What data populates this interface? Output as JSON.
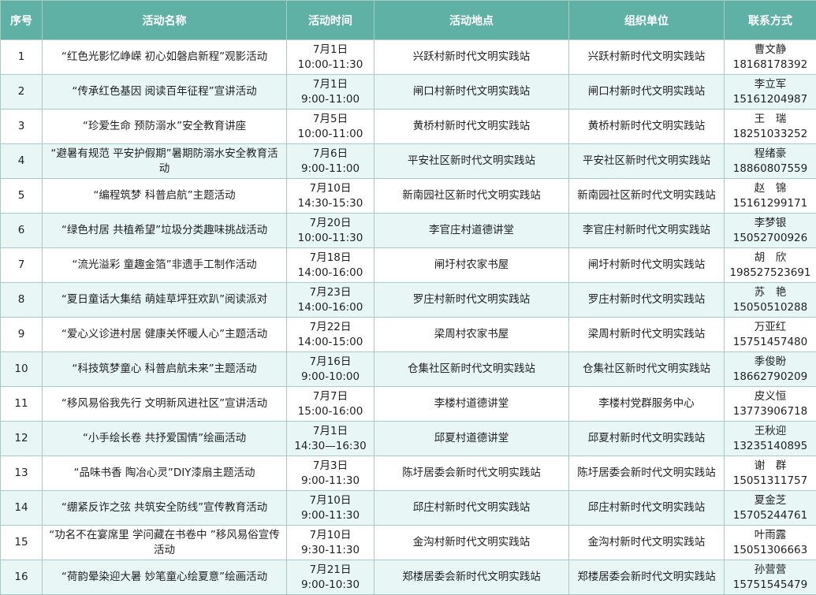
{
  "header": {
    "no": "序号",
    "name": "活动名称",
    "time": "活动时间",
    "place": "活动地点",
    "org": "组织单位",
    "contact": "联系方式"
  },
  "rows": [
    {
      "no": "1",
      "name": "“红色光影忆峥嵘 初心如磐启新程”观影活动",
      "date": "7月1日",
      "hours": "10:00-11:30",
      "place": "兴跃村新时代文明实践站",
      "org": "兴跃村新时代文明实践站",
      "person": "曹文静",
      "phone": "18168178392"
    },
    {
      "no": "2",
      "name": "“传承红色基因 阅读百年征程”宣讲活动",
      "date": "7月1日",
      "hours": "9:00-11:00",
      "place": "闸口村新时代文明实践站",
      "org": "闸口村新时代文明实践站",
      "person": "李立军",
      "phone": "15161204987"
    },
    {
      "no": "3",
      "name": "“珍爱生命 预防溺水”安全教育讲座",
      "date": "7月5日",
      "hours": "10:00-11:00",
      "place": "黄桥村新时代文明实践站",
      "org": "黄桥村新时代文明实践站",
      "person": "王　瑞",
      "phone": "18251033252"
    },
    {
      "no": "4",
      "name": "“避暑有规范 平安护假期”暑期防溺水安全教育活动",
      "date": "7月6日",
      "hours": "9:00-11:00",
      "place": "平安社区新时代文明实践站",
      "org": "平安社区新时代文明实践站",
      "person": "程绪豪",
      "phone": "18860807559"
    },
    {
      "no": "5",
      "name": "“编程筑梦 科普启航”主题活动",
      "date": "7月10日",
      "hours": "14:30-15:30",
      "place": "新南园社区新时代文明实践站",
      "org": "新南园社区新时代文明实践站",
      "person": "赵　锦",
      "phone": "15161299171"
    },
    {
      "no": "6",
      "name": "“绿色村居 共植希望”垃圾分类趣味挑战活动",
      "date": "7月20日",
      "hours": "10:00-11:30",
      "place": "李官庄村道德讲堂",
      "org": "李官庄村新时代文明实践站",
      "person": "李梦银",
      "phone": "15052700926"
    },
    {
      "no": "7",
      "name": "“流光溢彩 童趣金箔”非遗手工制作活动",
      "date": "7月18日",
      "hours": "14:00-16:00",
      "place": "闸圩村农家书屋",
      "org": "闸圩村新时代文明实践站",
      "person": "胡　欣",
      "phone": "198527523691"
    },
    {
      "no": "8",
      "name": "“夏日童话大集结 萌娃草坪狂欢趴”阅读派对",
      "date": "7月23日",
      "hours": "14:00-16:00",
      "place": "罗庄村新时代文明实践站",
      "org": "罗庄村新时代文明实践站",
      "person": "苏　艳",
      "phone": "15050510288"
    },
    {
      "no": "9",
      "name": "“爱心义诊进村居 健康关怀暖人心”主题活动",
      "date": "7月22日",
      "hours": "14:00-15:00",
      "place": "梁周村农家书屋",
      "org": "梁周村新时代文明实践站",
      "person": "万亚红",
      "phone": "15751457480"
    },
    {
      "no": "10",
      "name": "“科技筑梦童心 科普启航未来”主题活动",
      "date": "7月16日",
      "hours": "9:00-10:00",
      "place": "仓集社区新时代文明实践站",
      "org": "仓集社区新时代文明实践站",
      "person": "季俊盼",
      "phone": "18662790209"
    },
    {
      "no": "11",
      "name": "“移风易俗我先行 文明新风进社区”宣讲活动",
      "date": "7月7日",
      "hours": "15:00-16:00",
      "place": "李楼村道德讲堂",
      "org": "李楼村党群服务中心",
      "person": "皮义恒",
      "phone": "13773906718"
    },
    {
      "no": "12",
      "name": "“小手绘长卷 共抒爱国情”绘画活动",
      "date": "7月1日",
      "hours": "14:30—16:30",
      "place": "邱夏村道德讲堂",
      "org": "邱夏村新时代文明实践站",
      "person": "王秋迎",
      "phone": "13235140895"
    },
    {
      "no": "13",
      "name": "“品味书香 陶冶心灵”DIY漆扇主题活动",
      "date": "7月3日",
      "hours": "9:00-11:30",
      "place": "陈圩居委会新时代文明实践站",
      "org": "陈圩居委会新时代文明实践站",
      "person": "谢　群",
      "phone": "15051311757"
    },
    {
      "no": "14",
      "name": "“绷紧反诈之弦 共筑安全防线”宣传教育活动",
      "date": "7月10日",
      "hours": "9:00-11:30",
      "place": "邱庄村新时代文明实践站",
      "org": "邱庄村新时代文明实践站",
      "person": "夏金芝",
      "phone": "15705244761"
    },
    {
      "no": "15",
      "name": "“功名不在宴席里 学问藏在书卷中 ”移风易俗宣传活动",
      "date": "7月10日",
      "hours": "9:30-11:30",
      "place": "金沟村新时代文明实践站",
      "org": "金沟村新时代文明实践站",
      "person": "叶雨露",
      "phone": "15051306663"
    },
    {
      "no": "16",
      "name": "“荷韵晕染迎大暑 妙笔童心绘夏意”绘画活动",
      "date": "7月21日",
      "hours": "9:00-10:30",
      "place": "郑楼居委会新时代文明实践站",
      "org": "郑楼居委会新时代文明实践站",
      "person": "孙营营",
      "phone": "15751545479"
    }
  ]
}
